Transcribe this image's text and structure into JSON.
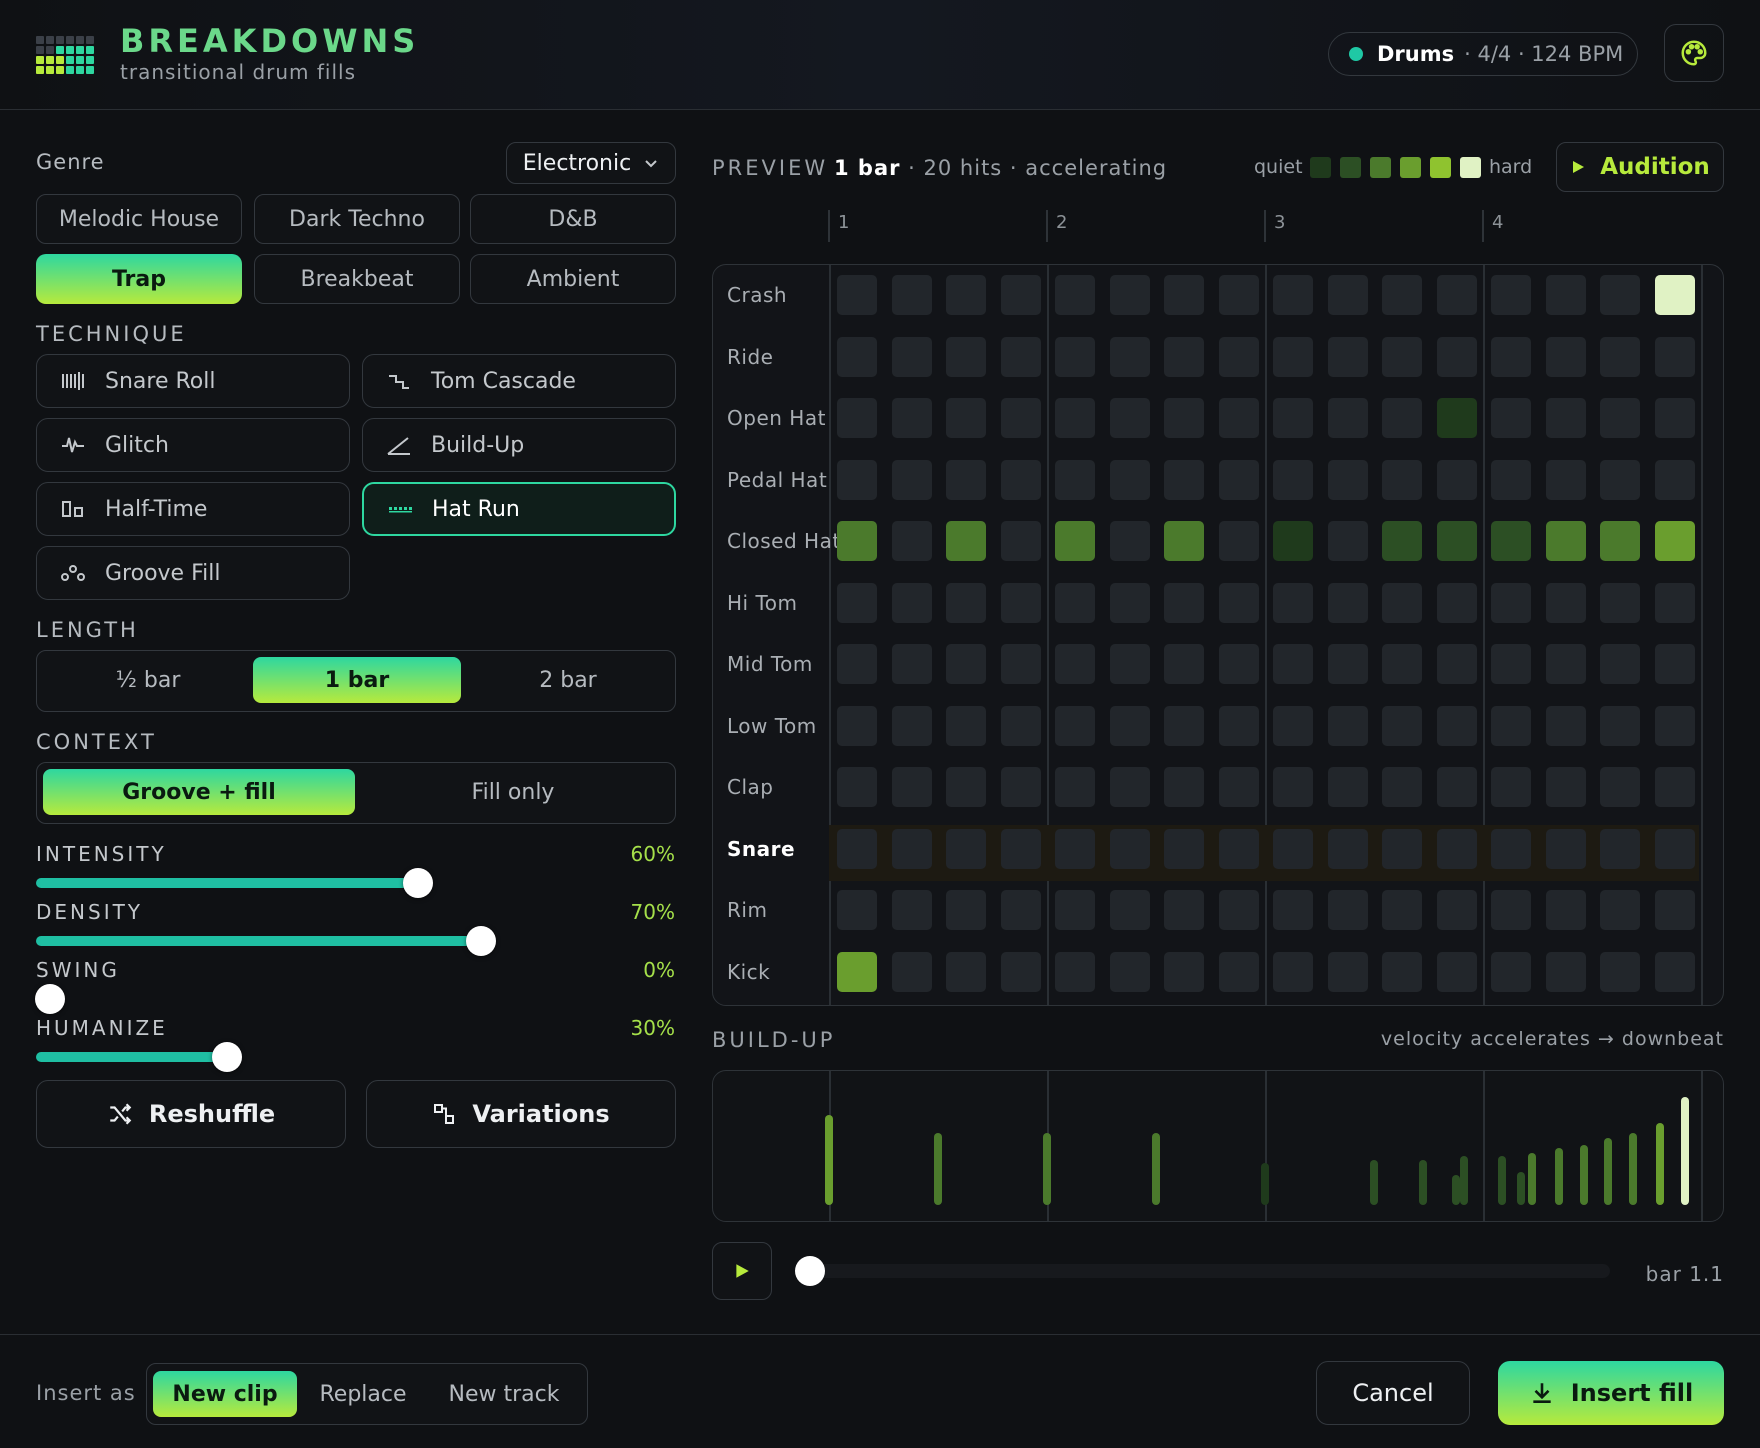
{
  "header": {
    "title": "BREAKDOWNS",
    "subtitle": "transitional drum fills",
    "track_name": "Drums",
    "track_meta": "· 4/4 · 124 BPM",
    "status_color": "#1fc8a5"
  },
  "genre": {
    "label": "Genre",
    "dropdown": "Electronic",
    "options": [
      "Melodic House",
      "Dark Techno",
      "D&B",
      "Trap",
      "Breakbeat",
      "Ambient"
    ],
    "selected": "Trap"
  },
  "technique": {
    "label": "TECHNIQUE",
    "options": [
      {
        "label": "Snare Roll",
        "icon": "snare-roll-icon"
      },
      {
        "label": "Tom Cascade",
        "icon": "tom-cascade-icon"
      },
      {
        "label": "Glitch",
        "icon": "glitch-icon"
      },
      {
        "label": "Build-Up",
        "icon": "build-up-icon"
      },
      {
        "label": "Half-Time",
        "icon": "half-time-icon"
      },
      {
        "label": "Hat Run",
        "icon": "hat-run-icon"
      },
      {
        "label": "Groove Fill",
        "icon": "groove-fill-icon"
      }
    ],
    "selected": "Hat Run"
  },
  "length": {
    "label": "LENGTH",
    "options": [
      "½ bar",
      "1 bar",
      "2 bar"
    ],
    "selected": "1 bar"
  },
  "context": {
    "label": "CONTEXT",
    "options": [
      "Groove + fill",
      "Fill only"
    ],
    "selected": "Groove + fill"
  },
  "sliders": [
    {
      "label": "INTENSITY",
      "value": 60,
      "display": "60%"
    },
    {
      "label": "DENSITY",
      "value": 70,
      "display": "70%"
    },
    {
      "label": "SWING",
      "value": 0,
      "display": "0%"
    },
    {
      "label": "HUMANIZE",
      "value": 30,
      "display": "30%"
    }
  ],
  "actions": {
    "reshuffle": "Reshuffle",
    "variations": "Variations"
  },
  "preview": {
    "label": "PREVIEW",
    "length": "1 bar",
    "info": "· 20 hits · accelerating",
    "legend_quiet": "quiet",
    "legend_hard": "hard",
    "legend_colors": [
      "#1f3a1c",
      "#2c4f24",
      "#4b7a2c",
      "#6a9e2e",
      "#8fc32f",
      "#e0f2c4"
    ],
    "audition": "Audition",
    "bars": [
      "1",
      "2",
      "3",
      "4"
    ],
    "rows": [
      "Crash",
      "Ride",
      "Open Hat",
      "Pedal Hat",
      "Closed Hat",
      "Hi Tom",
      "Mid Tom",
      "Low Tom",
      "Clap",
      "Snare",
      "Rim",
      "Kick"
    ],
    "highlight_row": "Snare",
    "hits": [
      {
        "row": 0,
        "step": 15,
        "level": 6
      },
      {
        "row": 2,
        "step": 11,
        "level": 1
      },
      {
        "row": 4,
        "step": 0,
        "level": 3
      },
      {
        "row": 4,
        "step": 2,
        "level": 3
      },
      {
        "row": 4,
        "step": 4,
        "level": 3
      },
      {
        "row": 4,
        "step": 6,
        "level": 3
      },
      {
        "row": 4,
        "step": 8,
        "level": 1
      },
      {
        "row": 4,
        "step": 10,
        "level": 2
      },
      {
        "row": 4,
        "step": 11,
        "level": 2
      },
      {
        "row": 4,
        "step": 12,
        "level": 2
      },
      {
        "row": 4,
        "step": 13,
        "level": 3
      },
      {
        "row": 4,
        "step": 14,
        "level": 3
      },
      {
        "row": 4,
        "step": 15,
        "level": 4
      },
      {
        "row": 11,
        "step": 0,
        "level": 4
      }
    ]
  },
  "buildup": {
    "label": "BUILD-UP",
    "caption": "velocity accelerates → downbeat",
    "bars": [
      {
        "pos": 0.0,
        "v": 0.6,
        "level": 4
      },
      {
        "pos": 2.0,
        "v": 0.48,
        "level": 3
      },
      {
        "pos": 4.0,
        "v": 0.48,
        "level": 3
      },
      {
        "pos": 6.0,
        "v": 0.48,
        "level": 3
      },
      {
        "pos": 8.0,
        "v": 0.28,
        "level": 1
      },
      {
        "pos": 10.0,
        "v": 0.3,
        "level": 2
      },
      {
        "pos": 10.9,
        "v": 0.3,
        "level": 2
      },
      {
        "pos": 11.5,
        "v": 0.2,
        "level": 2
      },
      {
        "pos": 11.65,
        "v": 0.33,
        "level": 2
      },
      {
        "pos": 12.35,
        "v": 0.33,
        "level": 2
      },
      {
        "pos": 12.7,
        "v": 0.22,
        "level": 2
      },
      {
        "pos": 12.9,
        "v": 0.35,
        "level": 3
      },
      {
        "pos": 13.4,
        "v": 0.38,
        "level": 3
      },
      {
        "pos": 13.85,
        "v": 0.4,
        "level": 3
      },
      {
        "pos": 14.3,
        "v": 0.45,
        "level": 3
      },
      {
        "pos": 14.75,
        "v": 0.48,
        "level": 3
      },
      {
        "pos": 15.25,
        "v": 0.55,
        "level": 4
      },
      {
        "pos": 15.7,
        "v": 0.72,
        "level": 6
      }
    ]
  },
  "transport": {
    "position": "bar 1.1",
    "progress": 0.0
  },
  "footer": {
    "insert_as": "Insert as",
    "options": [
      "New clip",
      "Replace",
      "New track"
    ],
    "selected": "New clip",
    "cancel": "Cancel",
    "insert": "Insert fill"
  }
}
